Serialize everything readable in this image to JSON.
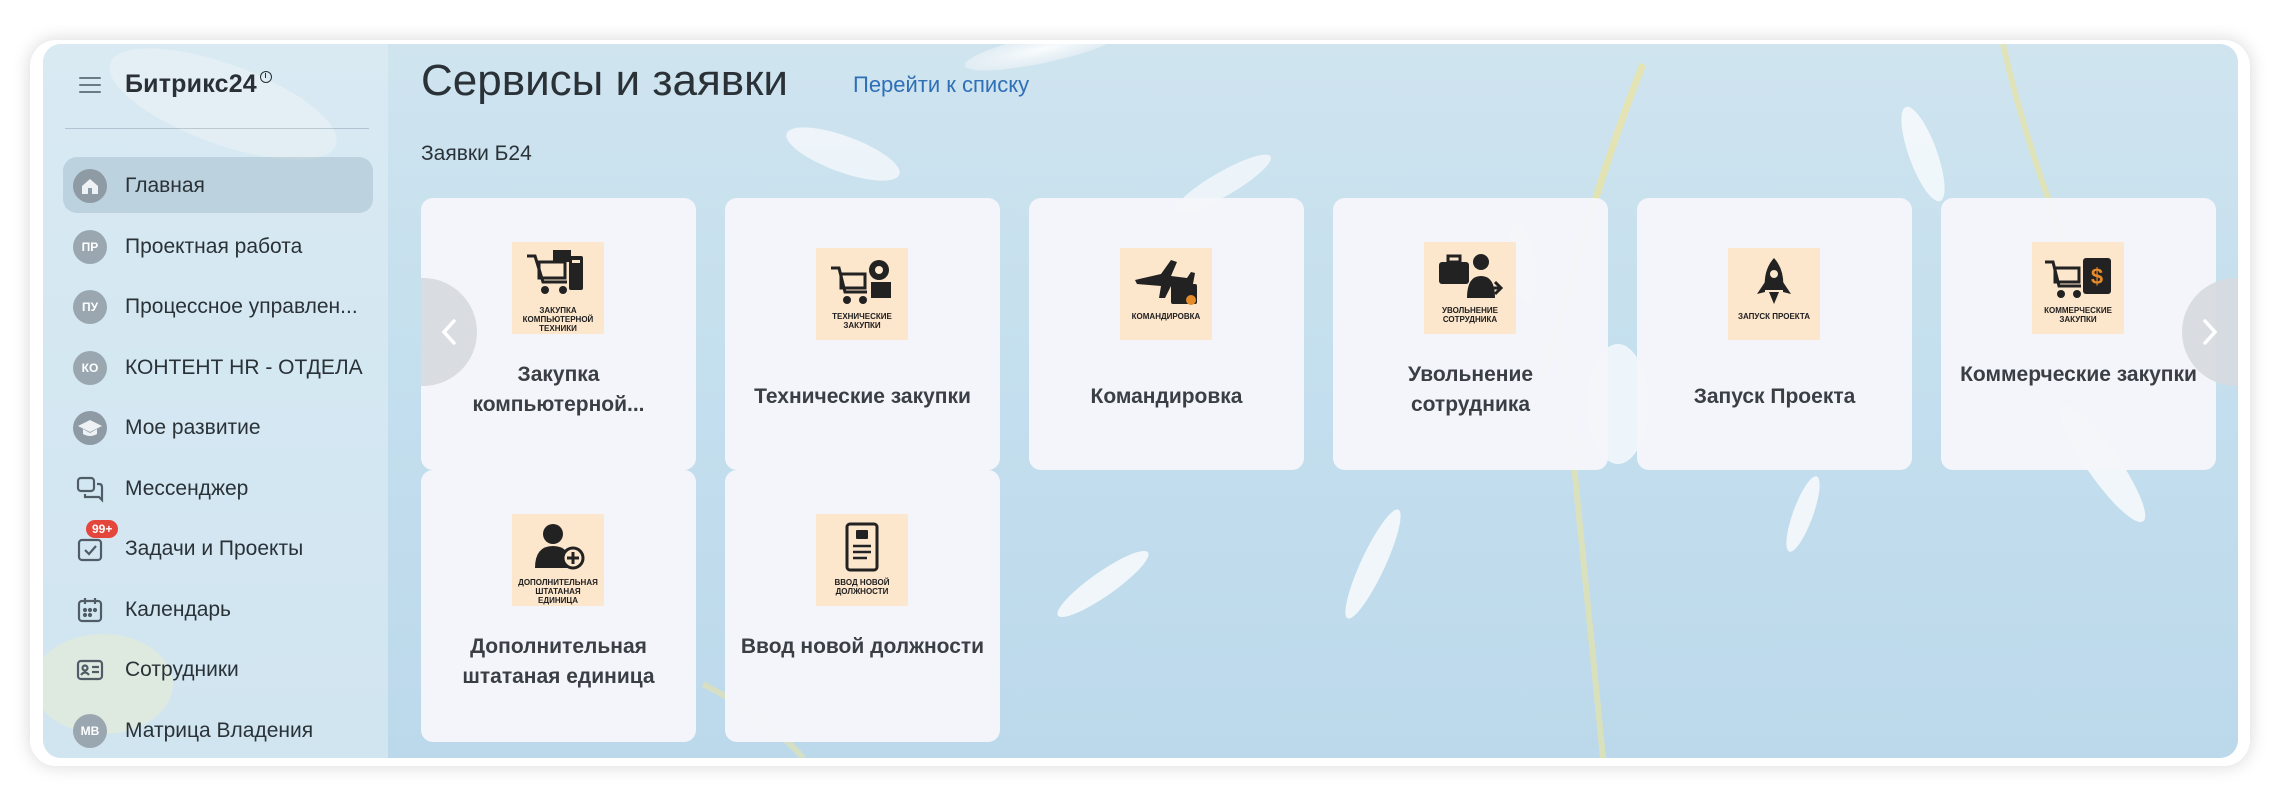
{
  "app": {
    "logo": "Битрикс24"
  },
  "sidebar": {
    "items": [
      {
        "label": "Главная",
        "icon": "home-icon",
        "active": true
      },
      {
        "label": "Проектная работа",
        "avatar": "ПР"
      },
      {
        "label": "Процессное управлен...",
        "avatar": "ПУ"
      },
      {
        "label": "КОНТЕНТ HR - ОТДЕЛА",
        "avatar": "КО"
      },
      {
        "label": "Мое развитие",
        "icon": "graduation-cap-icon"
      },
      {
        "label": "Мессенджер",
        "icon": "chat-bubbles-icon"
      },
      {
        "label": "Задачи и Проекты",
        "icon": "task-check-icon",
        "badge": "99+"
      },
      {
        "label": "Календарь",
        "icon": "calendar-icon"
      },
      {
        "label": "Сотрудники",
        "icon": "id-card-icon"
      },
      {
        "label": "Матрица Владения",
        "avatar": "МВ"
      }
    ]
  },
  "main": {
    "title": "Сервисы и заявки",
    "list_link": "Перейти к списку",
    "section_title": "Заявки Б24",
    "tiles": [
      {
        "label": "Закупка компьютерной...",
        "icon_caption": "Закупка компьютерной техники",
        "icon": "computer-cart-icon"
      },
      {
        "label": "Технические закупки",
        "icon_caption": "Технические закупки",
        "icon": "cart-gear-icon"
      },
      {
        "label": "Командировка",
        "icon_caption": "Командировка",
        "icon": "plane-briefcase-icon"
      },
      {
        "label": "Увольнение сотрудника",
        "icon_caption": "Увольнение сотрудника",
        "icon": "person-exit-icon"
      },
      {
        "label": "Запуск Проекта",
        "icon_caption": "Запуск проекта",
        "icon": "rocket-icon"
      },
      {
        "label": "Коммерческие закупки",
        "icon_caption": "Коммерческие закупки",
        "icon": "cart-money-icon"
      },
      {
        "label": "Дополнительная штатаная единица",
        "icon_caption": "Дополнительная штатаная единица",
        "icon": "person-add-icon"
      },
      {
        "label": "Ввод новой должности",
        "icon_caption": "Ввод новой должности",
        "icon": "document-badge-icon"
      }
    ]
  },
  "colors": {
    "accent_link": "#2f6fb6",
    "badge": "#e5463b",
    "tile_icon_bg": "#fce6cc"
  }
}
